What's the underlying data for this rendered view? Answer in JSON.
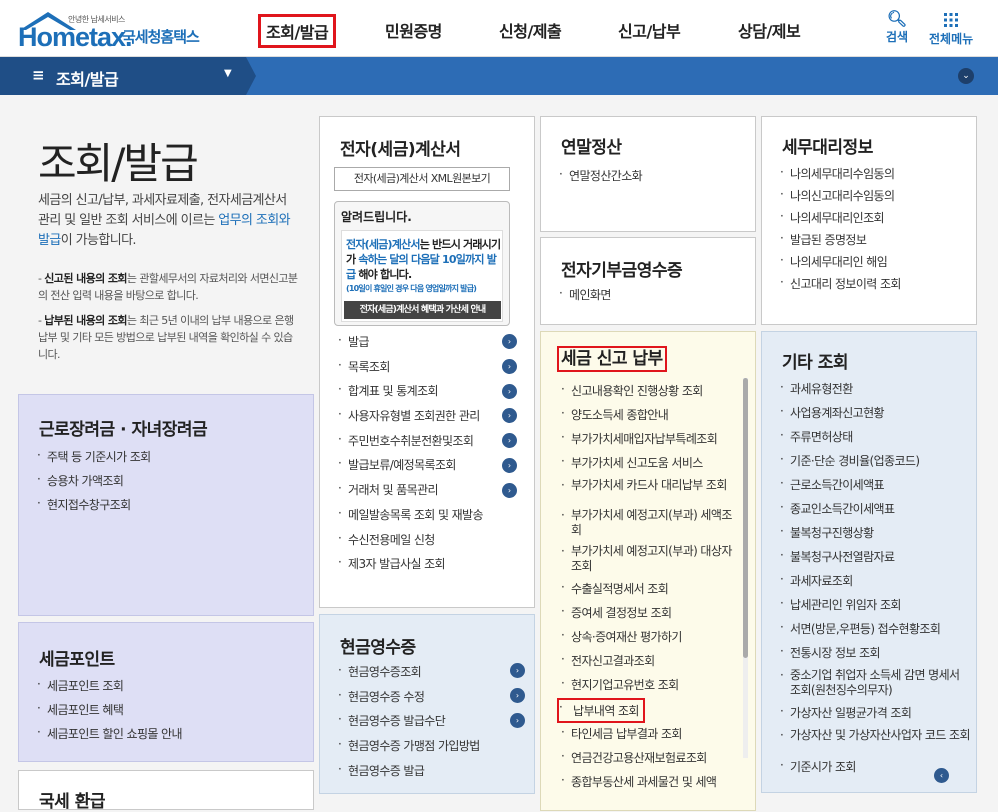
{
  "logo": {
    "small": "안녕한 납세서비스",
    "en": "Hometax.",
    "ko": "국세청홈택스"
  },
  "gnb": [
    "조회/발급",
    "민원증명",
    "신청/제출",
    "신고/납부",
    "상담/제보"
  ],
  "top": {
    "search": "검색",
    "menu": "전체메뉴"
  },
  "bar": {
    "title": "조회/발급"
  },
  "intro": {
    "title": "조회/발급",
    "desc_a": "세금의 신고/납부, 과세자료제출, 전자세금계산서 관리 및 일반 조회 서비스에 이르는 ",
    "desc_hl": "업무의 조회와 발급",
    "desc_b": "이 가능합니다.",
    "note1_b": "신고된 내용의 조회",
    "note1": "는 관할세무서의 자료처리와 서면신고분의 전산 입력 내용을 바탕으로 합니다.",
    "note2_b": "납부된 내용의 조회",
    "note2": "는 최근 5년 이내의 납부 내용으로 은행 납부 및 기타 모든 방법으로 납부된 내역을 확인하실 수 있습니다."
  },
  "labor": {
    "title": "근로장려금 · 자녀장려금",
    "items": [
      "주택 등 기준시가 조회",
      "승용차 가액조회",
      "현지접수창구조회"
    ]
  },
  "point": {
    "title": "세금포인트",
    "items": [
      "세금포인트 조회",
      "세금포인트 혜택",
      "세금포인트 할인 쇼핑몰 안내"
    ]
  },
  "refund": {
    "title": "국세 환급"
  },
  "einvoice": {
    "title": "전자(세금)계산서",
    "xml_btn": "전자(세금)계산서 XML원본보기",
    "notice_title": "알려드립니다.",
    "notice_1": "전자(세금)계산서",
    "notice_2": "는 반드시 거래시기가 ",
    "notice_3": "속하는 달의 다음달 10일까지 발급",
    "notice_4": " 해야 합니다.",
    "notice_small": "(10일이 휴일인 경우 다음 영업일까지 발급)",
    "notice_btn": "전자(세금)계산서 혜택과 가산세 안내",
    "items": [
      "발급",
      "목록조회",
      "합계표 및 통계조회",
      "사용자유형별 조회권한 관리",
      "주민번호수취분전환및조회",
      "발급보류/예정목록조회",
      "거래처 및 품목관리",
      "메일발송목록 조회 및 재발송",
      "수신전용메일 신청",
      "제3자 발급사실 조회"
    ]
  },
  "cash": {
    "title": "현금영수증",
    "items": [
      "현금영수증조회",
      "현금영수증 수정",
      "현금영수증 발급수단",
      "현금영수증 가맹점 가입방법",
      "현금영수증 발급"
    ]
  },
  "yearend": {
    "title": "연말정산",
    "items": [
      "연말정산간소화"
    ]
  },
  "donation": {
    "title": "전자기부금영수증",
    "items": [
      "메인화면"
    ]
  },
  "taxreport": {
    "title": "세금 신고 납부",
    "items": [
      "신고내용확인 진행상황 조회",
      "양도소득세 종합안내",
      "부가가치세매입자납부특례조회",
      "부가가치세 신고도움 서비스",
      "부가가치세 카드사 대리납부 조회",
      "부가가치세 예정고지(부과) 세액조회",
      "부가가치세 예정고지(부과) 대상자 조회",
      "수출실적명세서 조회",
      "증여세 결정정보 조회",
      "상속·증여재산 평가하기",
      "전자신고결과조회",
      "현지기업고유번호 조회",
      "납부내역 조회",
      "타인세금 납부결과 조회",
      "연금건강고용산재보험료조회",
      "종합부동산세 과세물건 및 세액"
    ]
  },
  "agent": {
    "title": "세무대리정보",
    "items": [
      "나의세무대리수임동의",
      "나의신고대리수임동의",
      "나의세무대리인조회",
      "발급된 증명정보",
      "나의세무대리인 해임",
      "신고대리 정보이력 조회"
    ]
  },
  "etc": {
    "title": "기타 조회",
    "items": [
      "과세유형전환",
      "사업용계좌신고현황",
      "주류면허상태",
      "기준·단순 경비율(업종코드)",
      "근로소득간이세액표",
      "종교인소득간이세액표",
      "불복청구진행상황",
      "불복청구사전열람자료",
      "과세자료조회",
      "납세관리인 위임자 조회",
      "서면(방문,우편등) 접수현황조회",
      "전통시장 정보 조회",
      "중소기업 취업자 소득세 감면 명세서 조회(원천징수의무자)",
      "가상자산 일평균가격 조회",
      "가상자산 및 가상자산사업자 코드 조회",
      "기준시가 조회"
    ]
  }
}
